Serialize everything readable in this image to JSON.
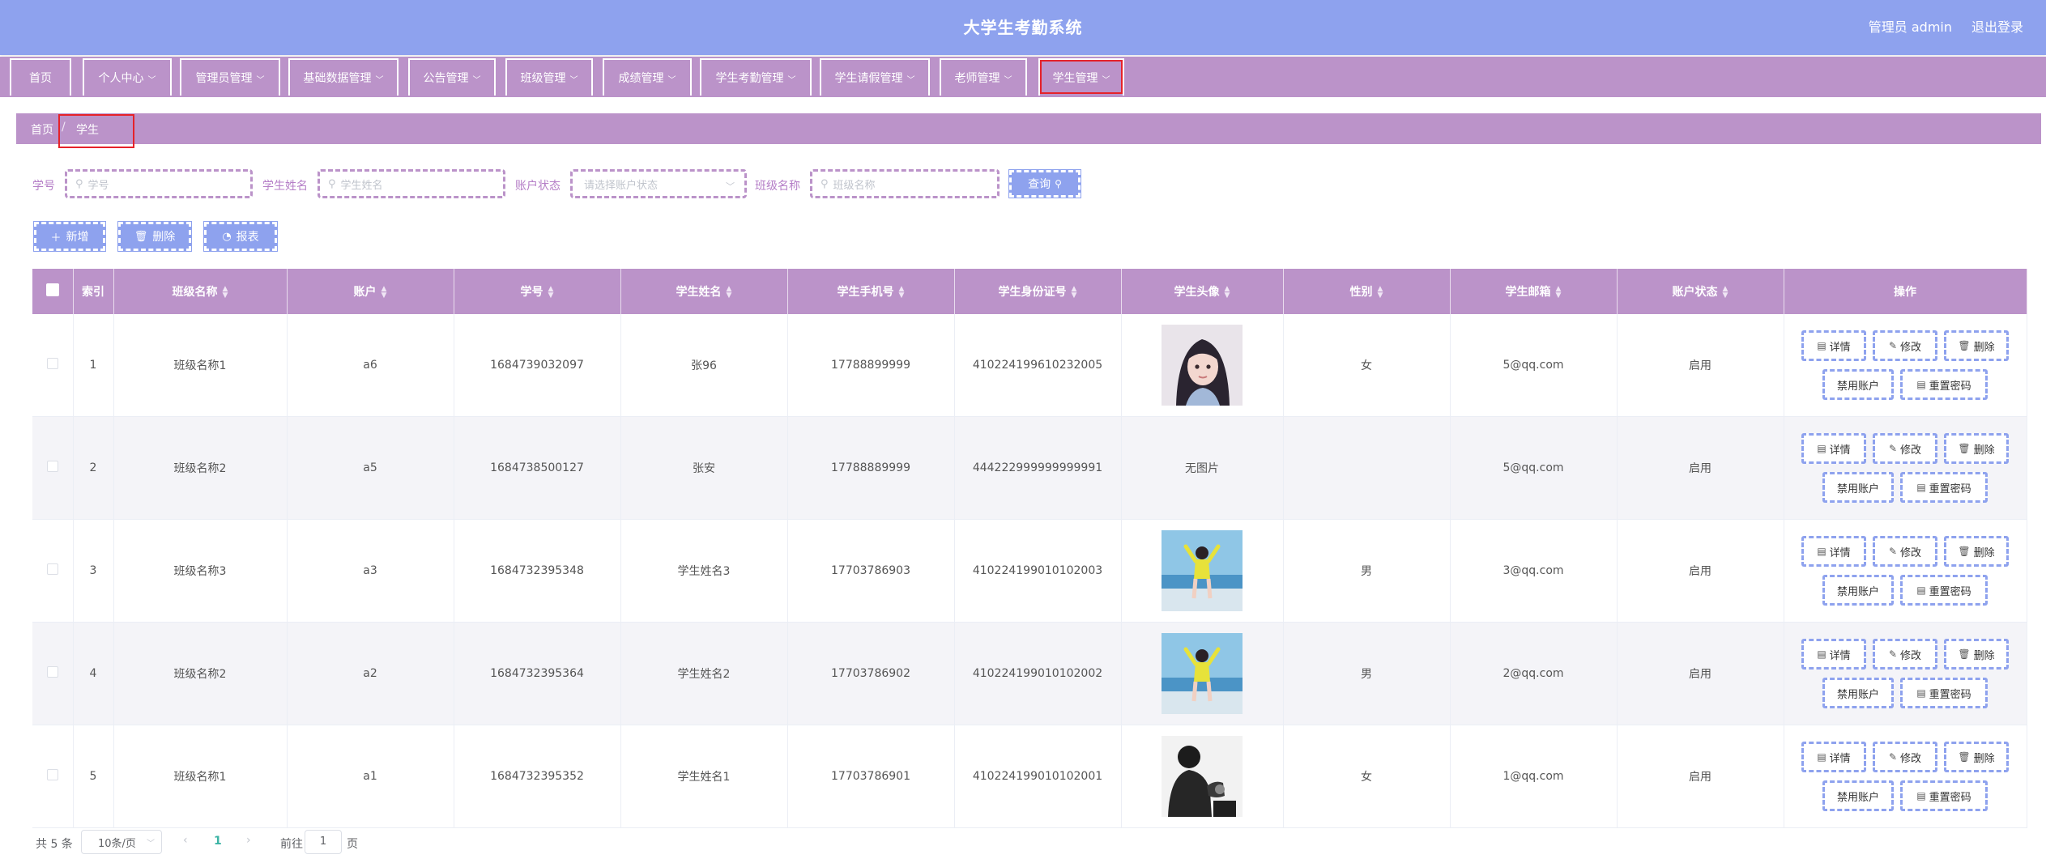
{
  "header": {
    "title": "大学生考勤系统",
    "user_label": "管理员 admin",
    "logout_label": "退出登录"
  },
  "nav": {
    "items": [
      {
        "label": "首页",
        "has_dropdown": false
      },
      {
        "label": "个人中心",
        "has_dropdown": true
      },
      {
        "label": "管理员管理",
        "has_dropdown": true
      },
      {
        "label": "基础数据管理",
        "has_dropdown": true
      },
      {
        "label": "公告管理",
        "has_dropdown": true
      },
      {
        "label": "班级管理",
        "has_dropdown": true
      },
      {
        "label": "成绩管理",
        "has_dropdown": true
      },
      {
        "label": "学生考勤管理",
        "has_dropdown": true
      },
      {
        "label": "学生请假管理",
        "has_dropdown": true
      },
      {
        "label": "老师管理",
        "has_dropdown": true
      },
      {
        "label": "学生管理",
        "has_dropdown": true,
        "active": true
      }
    ]
  },
  "breadcrumb": {
    "home": "首页",
    "separator": "/",
    "current": "学生"
  },
  "search": {
    "fields": [
      {
        "label": "学号",
        "placeholder": "学号",
        "type": "text"
      },
      {
        "label": "学生姓名",
        "placeholder": "学生姓名",
        "type": "text"
      },
      {
        "label": "账户状态",
        "placeholder": "请选择账户状态",
        "type": "select"
      },
      {
        "label": "班级名称",
        "placeholder": "班级名称",
        "type": "text"
      }
    ],
    "query_label": "查询"
  },
  "actions": {
    "add_label": "新增",
    "delete_label": "删除",
    "report_label": "报表"
  },
  "table": {
    "columns": [
      "",
      "索引",
      "班级名称",
      "账户",
      "学号",
      "学生姓名",
      "学生手机号",
      "学生身份证号",
      "学生头像",
      "性别",
      "学生邮箱",
      "账户状态",
      "操作"
    ],
    "sortable": [
      false,
      false,
      true,
      true,
      true,
      true,
      true,
      true,
      true,
      true,
      true,
      true,
      false
    ],
    "rows": [
      {
        "index": "1",
        "class_name": "班级名称1",
        "account": "a6",
        "student_no": "1684739032097",
        "name": "张96",
        "phone": "17788899999",
        "id_card": "410224199610232005",
        "avatar": "photo-girl-portrait",
        "avatar_text": "",
        "gender": "女",
        "email": "5@qq.com",
        "status": "启用"
      },
      {
        "index": "2",
        "class_name": "班级名称2",
        "account": "a5",
        "student_no": "1684738500127",
        "name": "张安",
        "phone": "17788889999",
        "id_card": "444222999999999991",
        "avatar": "",
        "avatar_text": "无图片",
        "gender": "",
        "email": "5@qq.com",
        "status": "启用"
      },
      {
        "index": "3",
        "class_name": "班级名称3",
        "account": "a3",
        "student_no": "1684732395348",
        "name": "学生姓名3",
        "phone": "17703786903",
        "id_card": "410224199010102003",
        "avatar": "photo-girl-beach",
        "avatar_text": "",
        "gender": "男",
        "email": "3@qq.com",
        "status": "启用"
      },
      {
        "index": "4",
        "class_name": "班级名称2",
        "account": "a2",
        "student_no": "1684732395364",
        "name": "学生姓名2",
        "phone": "17703786902",
        "id_card": "410224199010102002",
        "avatar": "photo-girl-beach",
        "avatar_text": "",
        "gender": "男",
        "email": "2@qq.com",
        "status": "启用"
      },
      {
        "index": "5",
        "class_name": "班级名称1",
        "account": "a1",
        "student_no": "1684732395352",
        "name": "学生姓名1",
        "phone": "17703786901",
        "id_card": "410224199010102001",
        "avatar": "photo-man-bw",
        "avatar_text": "",
        "gender": "女",
        "email": "1@qq.com",
        "status": "启用"
      }
    ],
    "row_actions": {
      "detail": "详情",
      "edit": "修改",
      "delete": "删除",
      "disable": "禁用账户",
      "reset": "重置密码"
    }
  },
  "pagination": {
    "total_label": "共 5 条",
    "page_size_label": "10条/页",
    "current_page": "1",
    "goto_label": "前往",
    "goto_value": "1",
    "page_suffix": "页"
  },
  "colors": {
    "header_bg": "#8ea2ee",
    "nav_bg": "#bb93c9",
    "button_bg": "#8ea2ee",
    "highlight_box": "#e5222a",
    "active_page": "#3cb4a5"
  }
}
